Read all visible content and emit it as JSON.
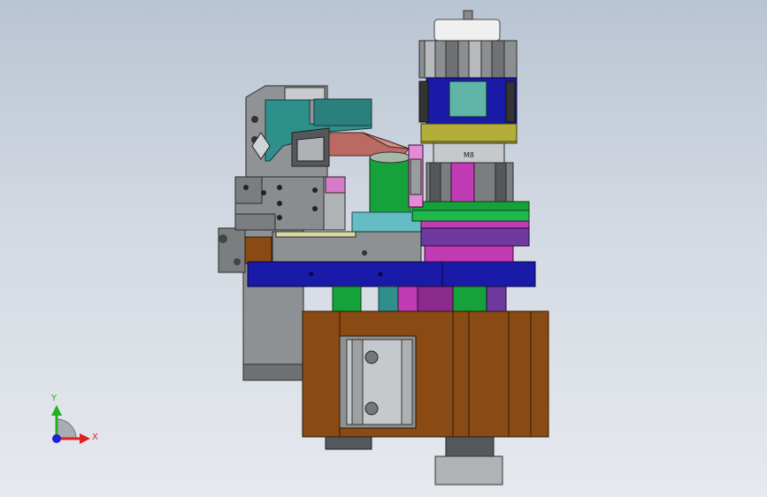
{
  "viewport": {
    "background_top": "#b9c4d3",
    "background_bottom": "#e6e9ee"
  },
  "model": {
    "part_label": "M8",
    "colors": {
      "steel": "#8e9194",
      "dark_steel": "#55585b",
      "teal": "#2f8f8a",
      "salmon": "#b86a63",
      "green": "#16a23a",
      "navy": "#1a1aa8",
      "brown": "#8a4a14",
      "olive": "#b4ad3a",
      "magenta": "#c13bb5",
      "purple": "#6f3aa0",
      "light_teal": "#64bcc5",
      "pink": "#e58ad6"
    }
  },
  "triad": {
    "x_label": "X",
    "y_label": "Y",
    "x_color": "#e02020",
    "y_color": "#20b020",
    "origin_color": "#2020d0"
  }
}
